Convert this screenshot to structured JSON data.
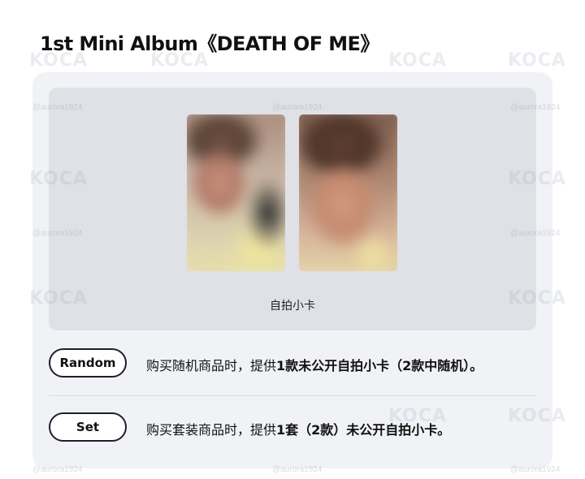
{
  "header": {
    "title": "1st Mini Album《DEATH OF ME》"
  },
  "photocards": {
    "label": "自拍小卡",
    "cards": [
      {
        "name": "photocard-1"
      },
      {
        "name": "photocard-2"
      }
    ]
  },
  "options": [
    {
      "button_label": "Random",
      "text_plain": "购买随机商品时，提供",
      "text_bold": "1款未公开自拍小卡（2款中随机）。"
    },
    {
      "button_label": "Set",
      "text_plain": "购买套装商品时，提供",
      "text_bold": "1套（2款）未公开自拍小卡。"
    }
  ],
  "watermarks": {
    "brand": "KOCA",
    "handle": "@aurora1924"
  },
  "colors": {
    "card_background": "#f1f2f5",
    "photo_panel_background": "#dfe1e6",
    "pill_border": "#1d1d2b",
    "text": "#111111"
  }
}
